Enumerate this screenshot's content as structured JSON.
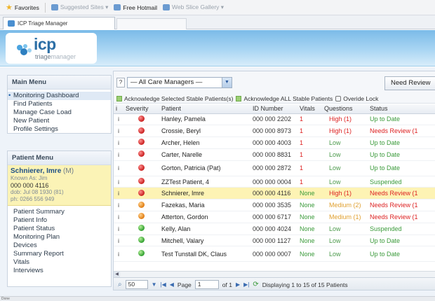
{
  "browser": {
    "favorites_label": "Favorites",
    "suggested_sites": "Suggested Sites ▾",
    "free_hotmail": "Free Hotmail",
    "web_slice_gallery": "Web Slice Gallery ▾",
    "tab_title": "ICP Triage Manager",
    "status_text": "Done"
  },
  "header": {
    "logo_main": "icp",
    "logo_sub_a": "triage",
    "logo_sub_b": "manager"
  },
  "main_menu": {
    "title": "Main Menu",
    "items": [
      {
        "label": "Monitoring Dashboard",
        "active": true
      },
      {
        "label": "Find Patients"
      },
      {
        "label": "Manage Case Load"
      },
      {
        "label": "New Patient"
      },
      {
        "label": "Profile Settings"
      }
    ]
  },
  "patient_menu": {
    "title": "Patient Menu",
    "name": "Schnierer, Imre",
    "sex": "(M)",
    "known_as": "Known As: Jim",
    "id": "000 000 4116",
    "dob": "dob: Jul 08 1930 (81)",
    "phone": "ph: 0266 556 949",
    "items": [
      "Patient Summary",
      "Patient Info",
      "Patient Status",
      "Monitoring Plan",
      "Devices",
      "Summary Report",
      "Vitals",
      "Interviews"
    ]
  },
  "toolbar": {
    "help": "?",
    "care_manager_select": "— All Care Managers —",
    "need_review_button": "Need Review",
    "ack_selected": "Acknowledge Selected Stable Patients(s)",
    "ack_all": "Acknowledge ALL Stable Patients",
    "override_lock": "Overide Lock"
  },
  "table": {
    "headers": {
      "info": "i",
      "severity": "Severity",
      "patient": "Patient",
      "id": "ID Number",
      "vitals": "Vitals",
      "questions": "Questions",
      "status": "Status"
    },
    "rows": [
      {
        "sev": "red",
        "patient": "Hanley, Pamela",
        "id": "000 000 2202",
        "vitals": "1",
        "vcls": "v-red",
        "questions": "High (1)",
        "qcls": "q-red",
        "status": "Up to Date",
        "scls": "s-green"
      },
      {
        "sev": "red",
        "patient": "Crossie, Beryl",
        "id": "000 000 8973",
        "vitals": "1",
        "vcls": "v-red",
        "questions": "High (1)",
        "qcls": "q-red",
        "status": "Needs Review (1",
        "scls": "s-red"
      },
      {
        "sev": "red",
        "patient": "Archer, Helen",
        "id": "000 000 4003",
        "vitals": "1",
        "vcls": "v-red",
        "questions": "Low",
        "qcls": "q-green",
        "status": "Up to Date",
        "scls": "s-green"
      },
      {
        "sev": "red",
        "patient": "Carter, Narelle",
        "id": "000 000 8831",
        "vitals": "1",
        "vcls": "v-red",
        "questions": "Low",
        "qcls": "q-green",
        "status": "Up to Date",
        "scls": "s-green"
      },
      {
        "sev": "red",
        "patient": "Gorton, Patricia (Pat)",
        "id": "000 000 2872",
        "vitals": "1",
        "vcls": "v-red",
        "questions": "Low",
        "qcls": "q-green",
        "status": "Up to Date",
        "scls": "s-green",
        "tall": true
      },
      {
        "sev": "red",
        "patient": "ZZTest Patient, 4",
        "id": "000 000 0004",
        "vitals": "1",
        "vcls": "v-red",
        "questions": "Low",
        "qcls": "q-green",
        "status": "Suspended",
        "scls": "s-green"
      },
      {
        "sev": "red",
        "patient": "Schnierer, Imre",
        "id": "000 000 4116",
        "vitals": "None",
        "vcls": "v-green",
        "questions": "High (1)",
        "qcls": "q-red",
        "status": "Needs Review (1",
        "scls": "s-red",
        "highlight": true
      },
      {
        "sev": "orange",
        "patient": "Fazekas, Maria",
        "id": "000 000 3535",
        "vitals": "None",
        "vcls": "v-green",
        "questions": "Medium (2)",
        "qcls": "q-orange",
        "status": "Needs Review (1",
        "scls": "s-red"
      },
      {
        "sev": "orange",
        "patient": "Atterton, Gordon",
        "id": "000 000 6717",
        "vitals": "None",
        "vcls": "v-green",
        "questions": "Medium (1)",
        "qcls": "q-orange",
        "status": "Needs Review (1",
        "scls": "s-red"
      },
      {
        "sev": "green",
        "patient": "Kelly, Alan",
        "id": "000 000 4024",
        "vitals": "None",
        "vcls": "v-green",
        "questions": "Low",
        "qcls": "q-green",
        "status": "Suspended",
        "scls": "s-green"
      },
      {
        "sev": "green",
        "patient": "Mitchell, Valary",
        "id": "000 000 1127",
        "vitals": "None",
        "vcls": "v-green",
        "questions": "Low",
        "qcls": "q-green",
        "status": "Up to Date",
        "scls": "s-green"
      },
      {
        "sev": "green",
        "patient": "Test Tunstall DK, Claus",
        "id": "000 000 0007",
        "vitals": "None",
        "vcls": "v-green",
        "questions": "Low",
        "qcls": "q-green",
        "status": "Up to Date",
        "scls": "s-green",
        "tall": true
      }
    ]
  },
  "pager": {
    "page_size": "50",
    "page_label": "Page",
    "page_value": "1",
    "of_label": "of 1",
    "display_text": "Displaying 1 to 15 of 15 Patients"
  },
  "colors": {
    "accent": "#2d6fa6",
    "header_top": "#7bbbe8",
    "highlight_row": "#fdf3b4"
  }
}
